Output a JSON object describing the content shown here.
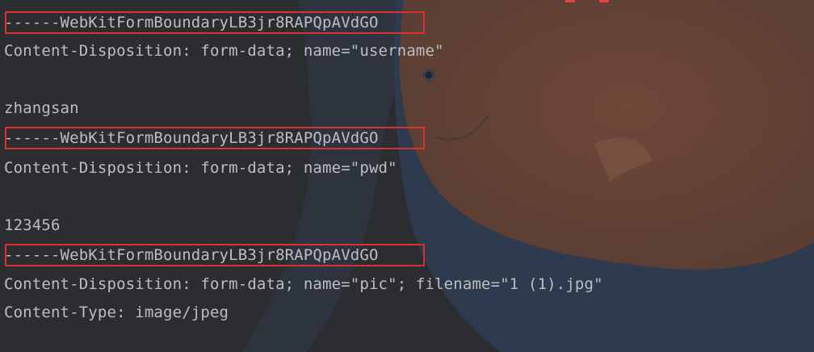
{
  "console": {
    "lines": [
      "------WebKitFormBoundaryLB3jr8RAPQpAVdGO",
      "Content-Disposition: form-data; name=\"username\"",
      "",
      "zhangsan",
      "------WebKitFormBoundaryLB3jr8RAPQpAVdGO",
      "Content-Disposition: form-data; name=\"pwd\"",
      "",
      "123456",
      "------WebKitFormBoundaryLB3jr8RAPQpAVdGO",
      "Content-Disposition: form-data; name=\"pic\"; filename=\"1 (1).jpg\"",
      "Content-Type: image/jpeg"
    ]
  },
  "colors": {
    "text": "#bcbec4",
    "highlight_border": "#d9312f",
    "background": "#2b2d30",
    "fish_body": "#6a4638"
  }
}
